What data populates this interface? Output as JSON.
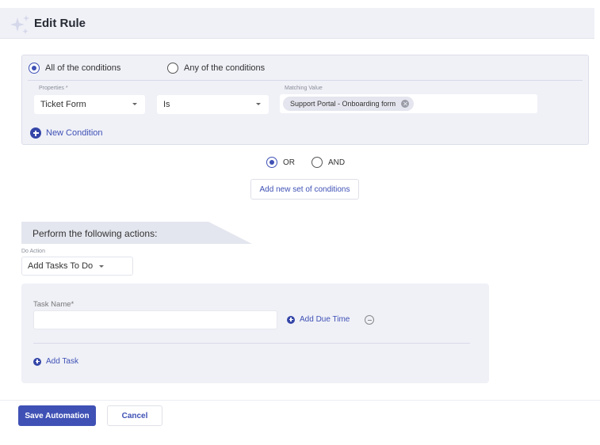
{
  "header": {
    "title": "Edit Rule",
    "icon": "sparkle-icon"
  },
  "conditions": {
    "match_options": [
      {
        "label": "All of the conditions",
        "selected": true
      },
      {
        "label": "Any of the conditions",
        "selected": false
      }
    ],
    "row": {
      "property_label": "Properties *",
      "property_value": "Ticket Form",
      "operator_value": "Is",
      "matching_value_label": "Matching Value",
      "matching_value_chips": [
        "Support Portal - Onboarding form"
      ]
    },
    "new_condition_label": "New Condition"
  },
  "logic": {
    "options": [
      {
        "label": "OR",
        "selected": true
      },
      {
        "label": "AND",
        "selected": false
      }
    ],
    "add_set_label": "Add new set of conditions"
  },
  "actions": {
    "section_title": "Perform the following actions:",
    "do_action_label": "Do Action",
    "do_action_value": "Add Tasks To Do",
    "task_name_label": "Task Name*",
    "task_name_value": "",
    "add_due_time_label": "Add Due Time",
    "add_task_label": "Add Task"
  },
  "footer": {
    "save_label": "Save Automation",
    "cancel_label": "Cancel"
  },
  "colors": {
    "accent": "#3f51b5",
    "panel_bg": "#f0f1f7"
  }
}
